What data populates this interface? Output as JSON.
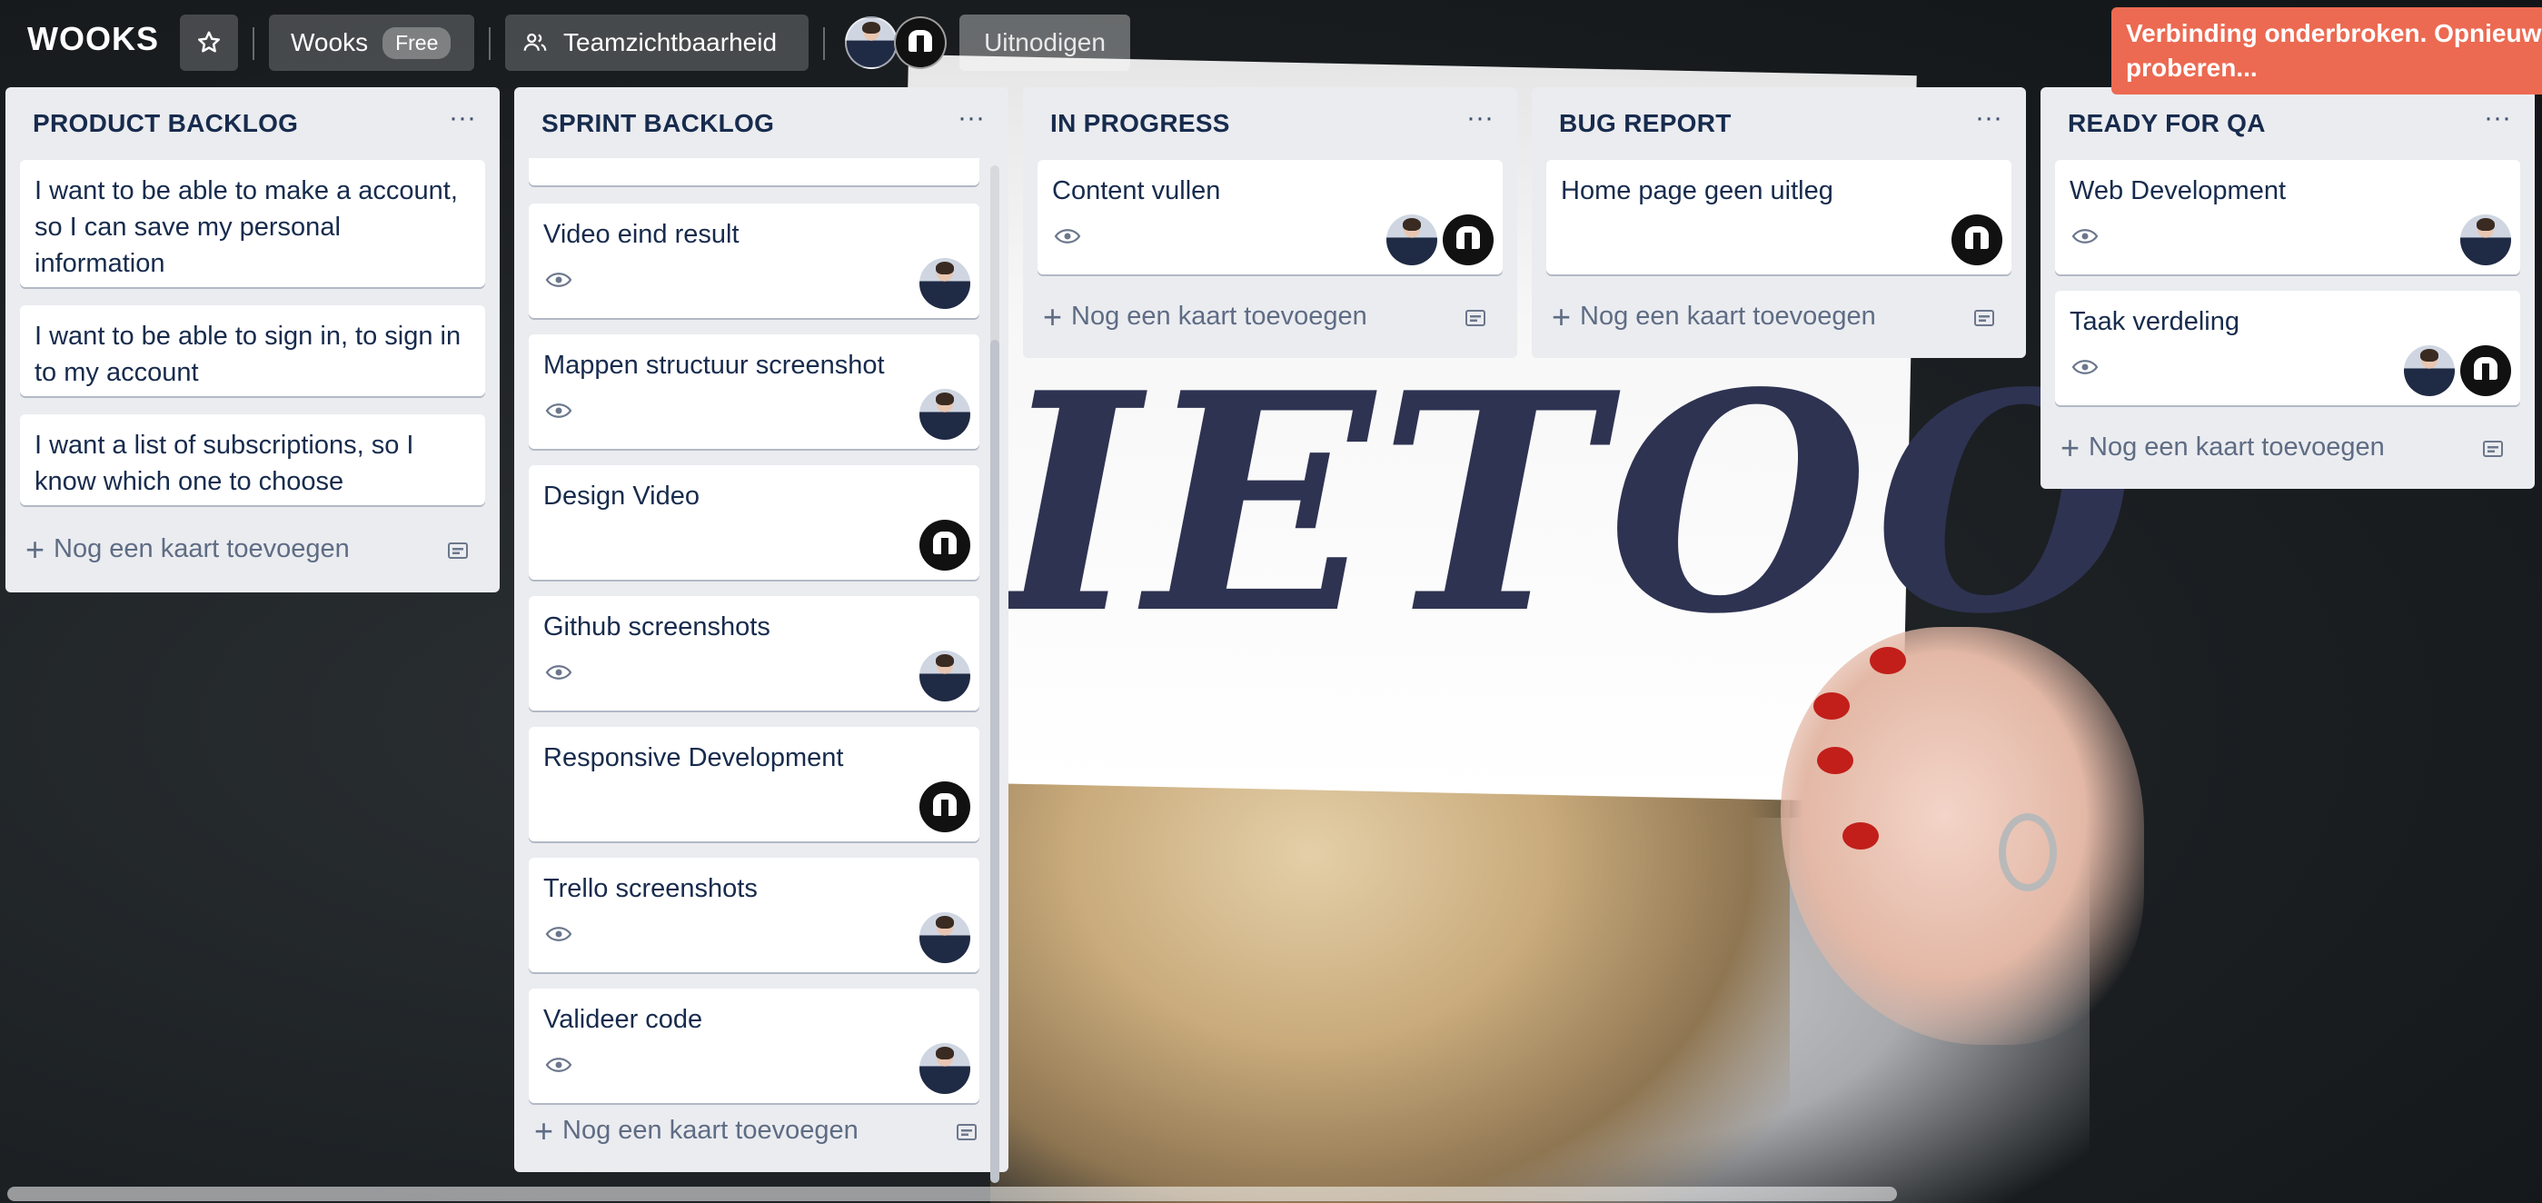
{
  "header": {
    "logo": "WOOKS",
    "board_name": "Wooks",
    "board_badge": "Free",
    "visibility": "Teamzichtbaarheid",
    "invite": "Uitnodigen"
  },
  "alert": {
    "line1": "Verbinding onderbroken. Opnieuw",
    "line2": "proberen..."
  },
  "lists": [
    {
      "title": "PRODUCT BACKLOG",
      "cards": [
        {
          "text": "I want to be able to make a account, so I can save my personal information"
        },
        {
          "text": "I want to be able to sign in, to sign in to my account"
        },
        {
          "text": "I want a list of subscriptions, so I know which one to choose"
        }
      ],
      "add_label": "Nog een kaart toevoegen"
    },
    {
      "title": "SPRINT BACKLOG",
      "cards": [
        {
          "text": "Video eind result"
        },
        {
          "text": "Mappen structuur screenshot"
        },
        {
          "text": "Design Video"
        },
        {
          "text": "Github screenshots"
        },
        {
          "text": "Responsive Development"
        },
        {
          "text": "Trello screenshots"
        },
        {
          "text": "Valideer code"
        }
      ],
      "add_label": "Nog een kaart toevoegen"
    },
    {
      "title": "IN PROGRESS",
      "cards": [
        {
          "text": "Content vullen"
        }
      ],
      "add_label": "Nog een kaart toevoegen"
    },
    {
      "title": "BUG REPORT",
      "cards": [
        {
          "text": "Home page geen uitleg"
        }
      ],
      "add_label": "Nog een kaart toevoegen"
    },
    {
      "title": "READY FOR QA",
      "cards": [
        {
          "text": "Web Development"
        },
        {
          "text": "Taak verdeling"
        }
      ],
      "add_label": "Nog een kaart toevoegen"
    }
  ],
  "icons": {
    "star": "star-icon",
    "visibility": "people-icon",
    "list_menu": "more-icon",
    "card_watch": "eye-icon",
    "add": "plus-icon",
    "template": "card-template-icon"
  },
  "colors": {
    "alert": "#ec6a52",
    "list_bg": "#ebecf0",
    "card_text": "#172b4d",
    "muted_text": "#5e6c84"
  }
}
